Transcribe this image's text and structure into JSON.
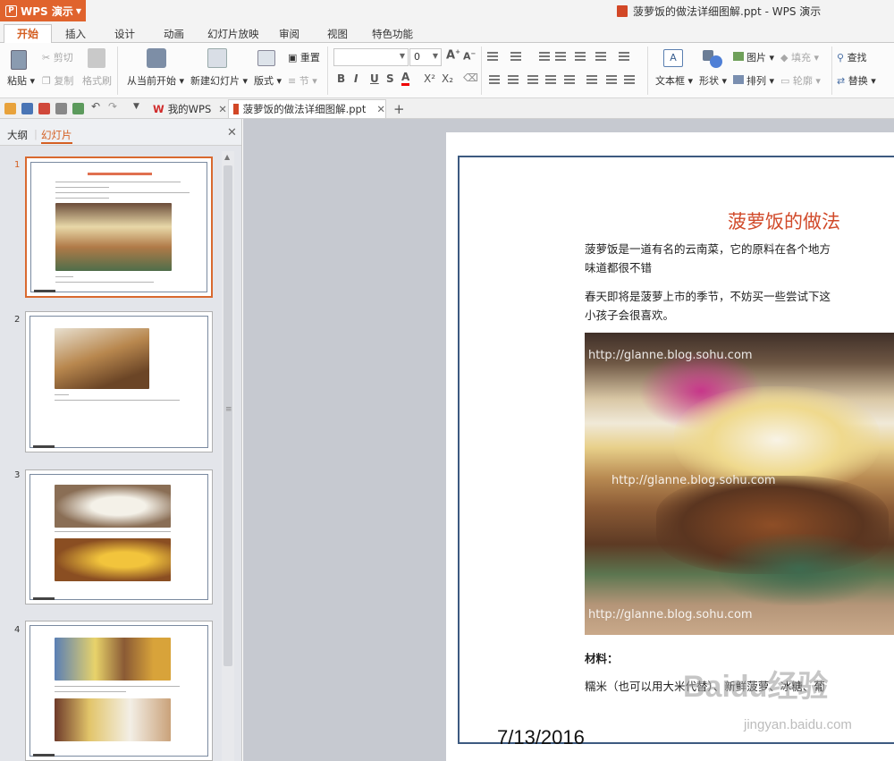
{
  "app": {
    "menu_label": "WPS 演示",
    "window_title": "菠萝饭的做法详细图解.ppt - WPS 演示"
  },
  "tabs": [
    "开始",
    "插入",
    "设计",
    "动画",
    "幻灯片放映",
    "审阅",
    "视图",
    "特色功能"
  ],
  "ribbon": {
    "paste": "粘贴",
    "cut": "剪切",
    "copy": "复制",
    "format_painter": "格式刷",
    "from_current": "从当前开始",
    "new_slide": "新建幻灯片",
    "layout": "版式",
    "reset": "重置",
    "section": "节",
    "font_size": "0",
    "text_box": "文本框",
    "shape": "形状",
    "picture": "图片",
    "fill": "填充",
    "arrange": "排列",
    "outline": "轮廓",
    "find": "查找",
    "replace": "替换"
  },
  "doc_tabs": {
    "my_wps": "我的WPS",
    "file": "菠萝饭的做法详细图解.ppt"
  },
  "panel": {
    "outline_tab": "大纲",
    "slides_tab": "幻灯片",
    "slide_numbers": [
      "1",
      "2",
      "3",
      "4"
    ]
  },
  "slide": {
    "title": "菠萝饭的做法",
    "para1_line1": "菠萝饭是一道有名的云南菜，它的原料在各个地方",
    "para1_line2": "味道都很不错",
    "para2_line1": "春天即将是菠萝上市的季节，不妨买一些尝试下这",
    "para2_line2": "小孩子会很喜欢。",
    "watermark_text": "http://glanne.blog.sohu.com",
    "materials_label": "材料：",
    "materials_line": "糯米（也可以用大米代替）、新鲜菠萝、冰糖、葡",
    "date": "7/13/2016"
  },
  "overlay": {
    "baidu_logo": "Baidu经验",
    "baidu_url": "jingyan.baidu.com"
  },
  "colors": {
    "accent": "#e0632d",
    "slide_title": "#d14a2a",
    "slide_border": "#3d5a80"
  }
}
